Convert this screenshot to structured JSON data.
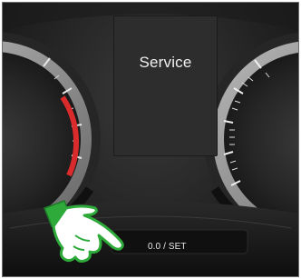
{
  "display": {
    "message": "Service"
  },
  "control": {
    "button_label": "0.0 / SET"
  },
  "colors": {
    "accent_green": "#2eaa3a",
    "needle_red": "#d92b2b",
    "dash_dark": "#1b1b1b"
  },
  "icons": {
    "pointer": "hand-pointer-icon"
  }
}
